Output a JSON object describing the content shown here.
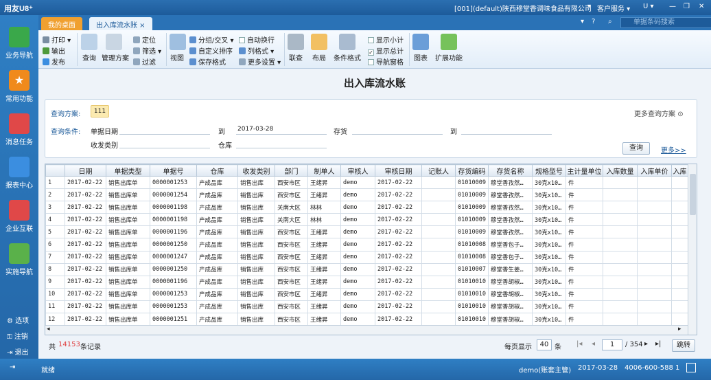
{
  "titlebar": {
    "logo": "用友U8⁺",
    "company": "[001](default)陕西穆堂香调味食品有限公司",
    "items": [
      "▾",
      "客户服务 ▾",
      "U ▾",
      "—",
      "❐",
      "✕"
    ]
  },
  "leftnav": {
    "items": [
      {
        "label": "业务导航",
        "color": "#3aa84a"
      },
      {
        "label": "常用功能",
        "color": "#f08a1c"
      },
      {
        "label": "消息任务",
        "color": "#e04848"
      },
      {
        "label": "报表中心",
        "color": "#3b8ee0"
      },
      {
        "label": "企业互联",
        "color": "#e04848"
      },
      {
        "label": "实施导航",
        "color": "#5ab14a"
      }
    ],
    "bottom": [
      "选项",
      "注销",
      "退出"
    ]
  },
  "tabs": [
    {
      "label": "我的桌面"
    },
    {
      "label": "出入库流水账 ×"
    }
  ],
  "search": {
    "placeholder": "单据条码搜索"
  },
  "toolbar": {
    "print": "打印",
    "export": "输出",
    "publish": "发布",
    "query": "查询",
    "manage": "管理方案",
    "locate": "定位",
    "filter": "筛选",
    "clear": "过滤",
    "view": "视图",
    "group": "分组/交叉",
    "custom_sort": "自定义排序",
    "save_format": "保存格式",
    "auto_wrap": "自动换行",
    "col_format": "列格式",
    "more_settings": "更多设置",
    "link": "联查",
    "layout": "布局",
    "cond_format": "条件格式",
    "show_subtotal": "显示小计",
    "show_total": "显示总计",
    "nav_pane": "导航窗格",
    "chart": "图表",
    "extend": "扩展功能"
  },
  "main": {
    "title": "出入库流水账",
    "query": {
      "plan_label": "查询方案:",
      "plan_value": "111",
      "cond_label": "查询条件:",
      "doc_date": "单据日期",
      "to1": "到",
      "date_to": "2017-03-28",
      "stock": "存货",
      "to2": "到",
      "category": "收发类别",
      "warehouse": "仓库",
      "more_plans": "更多查询方案",
      "query_btn": "查询",
      "more_btn": "更多>>"
    },
    "columns": [
      "",
      "日期",
      "单据类型",
      "单据号",
      "仓库",
      "收发类别",
      "部门",
      "制单人",
      "审核人",
      "审核日期",
      "记账人",
      "存货编码",
      "存货名称",
      "规格型号",
      "主计量单位",
      "入库数量",
      "入库单价",
      "入库"
    ],
    "rows": [
      [
        "1",
        "2017-02-22",
        "销售出库单",
        "0000001253",
        "产成品库",
        "销售出库",
        "西安市区",
        "王绪昇",
        "demo",
        "2017-02-22",
        "",
        "01010009",
        "穆堂香孜然…",
        "30克x10…",
        "件",
        "",
        "",
        ""
      ],
      [
        "2",
        "2017-02-22",
        "销售出库单",
        "0000001254",
        "产成品库",
        "销售出库",
        "西安市区",
        "王绪昇",
        "demo",
        "2017-02-22",
        "",
        "01010009",
        "穆堂香孜然…",
        "30克x10…",
        "件",
        "",
        "",
        ""
      ],
      [
        "3",
        "2017-02-22",
        "销售出库单",
        "0000001198",
        "产成品库",
        "销售出库",
        "关南大区",
        "林林",
        "demo",
        "2017-02-22",
        "",
        "01010009",
        "穆堂香孜然…",
        "30克x10…",
        "件",
        "",
        "",
        ""
      ],
      [
        "4",
        "2017-02-22",
        "销售出库单",
        "0000001198",
        "产成品库",
        "销售出库",
        "关南大区",
        "林林",
        "demo",
        "2017-02-22",
        "",
        "01010009",
        "穆堂香孜然…",
        "30克x10…",
        "件",
        "",
        "",
        ""
      ],
      [
        "5",
        "2017-02-22",
        "销售出库单",
        "0000001196",
        "产成品库",
        "销售出库",
        "西安市区",
        "王绪昇",
        "demo",
        "2017-02-22",
        "",
        "01010009",
        "穆堂香孜然…",
        "30克x10…",
        "件",
        "",
        "",
        ""
      ],
      [
        "6",
        "2017-02-22",
        "销售出库单",
        "0000001250",
        "产成品库",
        "销售出库",
        "西安市区",
        "王绪昇",
        "demo",
        "2017-02-22",
        "",
        "01010008",
        "穆堂香包子…",
        "30克x10…",
        "件",
        "",
        "",
        ""
      ],
      [
        "7",
        "2017-02-22",
        "销售出库单",
        "0000001247",
        "产成品库",
        "销售出库",
        "西安市区",
        "王绪昇",
        "demo",
        "2017-02-22",
        "",
        "01010008",
        "穆堂香包子…",
        "30克x10…",
        "件",
        "",
        "",
        ""
      ],
      [
        "8",
        "2017-02-22",
        "销售出库单",
        "0000001250",
        "产成品库",
        "销售出库",
        "西安市区",
        "王绪昇",
        "demo",
        "2017-02-22",
        "",
        "01010007",
        "穆堂香生姜…",
        "30克x10…",
        "件",
        "",
        "",
        ""
      ],
      [
        "9",
        "2017-02-22",
        "销售出库单",
        "0000001196",
        "产成品库",
        "销售出库",
        "西安市区",
        "王绪昇",
        "demo",
        "2017-02-22",
        "",
        "01010010",
        "穆堂香胡椒…",
        "30克x10…",
        "件",
        "",
        "",
        ""
      ],
      [
        "10",
        "2017-02-22",
        "销售出库单",
        "0000001253",
        "产成品库",
        "销售出库",
        "西安市区",
        "王绪昇",
        "demo",
        "2017-02-22",
        "",
        "01010010",
        "穆堂香胡椒…",
        "30克x10…",
        "件",
        "",
        "",
        ""
      ],
      [
        "11",
        "2017-02-22",
        "销售出库单",
        "0000001253",
        "产成品库",
        "销售出库",
        "西安市区",
        "王绪昇",
        "demo",
        "2017-02-22",
        "",
        "01010010",
        "穆堂香胡椒…",
        "30克x10…",
        "件",
        "",
        "",
        ""
      ],
      [
        "12",
        "2017-02-22",
        "销售出库单",
        "0000001251",
        "产成品库",
        "销售出库",
        "西安市区",
        "王绪昇",
        "demo",
        "2017-02-22",
        "",
        "01010010",
        "穆堂香胡椒…",
        "30克x10…",
        "件",
        "",
        "",
        ""
      ]
    ],
    "footer": {
      "total_prefix": "共",
      "total_count": "14153",
      "total_suffix": "条记录",
      "per_page_label": "每页显示",
      "per_page": "40",
      "per_page_unit": "条",
      "page": "1",
      "pages": "/ 354",
      "jump": "跳转"
    }
  },
  "status": {
    "ready": "就绪",
    "user": "demo(账套主管)",
    "date": "2017-03-28",
    "phone": "4006-600-588 1"
  }
}
